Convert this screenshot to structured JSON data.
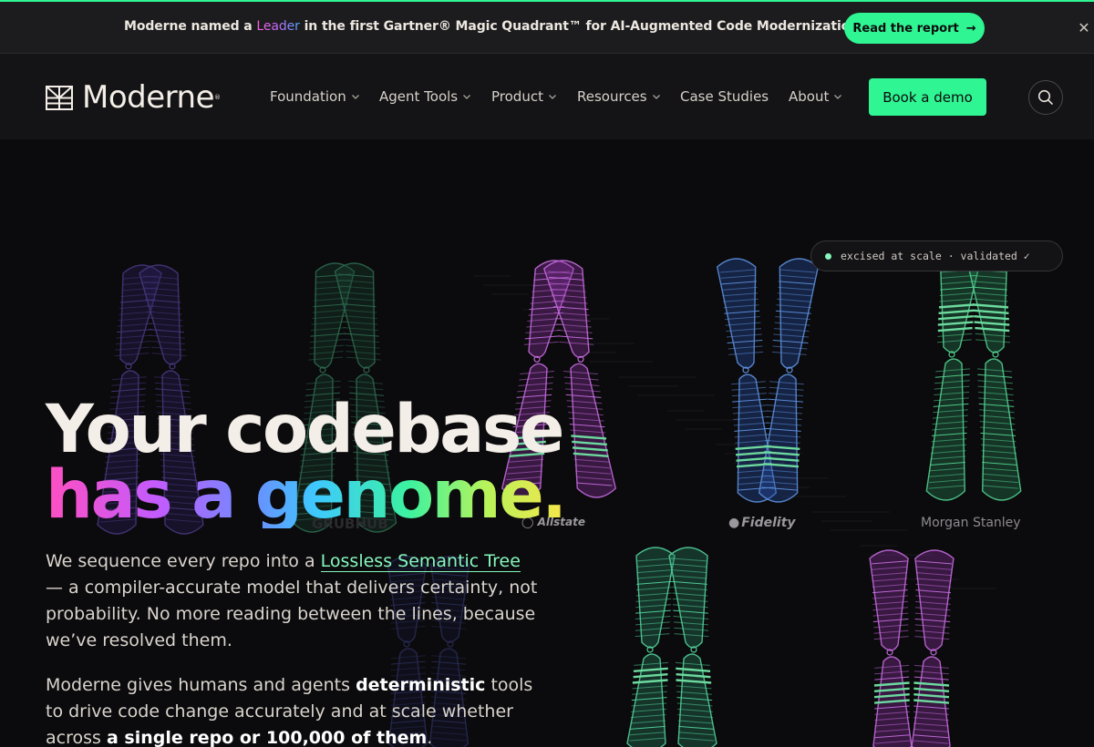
{
  "announcement": {
    "text_before": "Moderne named a ",
    "highlight": "Leader",
    "text_after": " in the first Gartner® Magic Quadrant™ for AI-Augmented Code Modernization Tools.",
    "button_label": "Read the report",
    "button_arrow": "→",
    "close_label": "✕"
  },
  "nav": {
    "logo_text": "Moderne",
    "logo_mark": "®",
    "items": [
      {
        "label": "Foundation",
        "dropdown": true
      },
      {
        "label": "Agent Tools",
        "dropdown": true
      },
      {
        "label": "Product",
        "dropdown": true
      },
      {
        "label": "Resources",
        "dropdown": true
      },
      {
        "label": "Case Studies",
        "dropdown": false
      },
      {
        "label": "About",
        "dropdown": true
      }
    ],
    "cta_label": "Book a demo",
    "search_icon": "search-icon"
  },
  "hero": {
    "badge_text": "excised at scale · validated ✓",
    "headline_line1": "Your codebase",
    "headline_line2": "has a genome.",
    "para1_before": "We sequence every repo into a ",
    "para1_link": "Lossless Semantic Tree",
    "para1_after": " — a compiler-accurate model that delivers certainty, not probability. No more reading between the lines, because we’ve resolved them.",
    "para2_before": "Moderne gives humans and agents ",
    "para2_bold1": "deterministic",
    "para2_mid": " tools to drive code change accurately and at scale whether across ",
    "para2_bold2": "a single repo or 100,000 of them",
    "para2_end": ".",
    "brands": {
      "grubhub": "GRUBHUB",
      "allstate": "Allstate",
      "fidelity": "Fidelity",
      "morgan": "Morgan Stanley"
    }
  },
  "colors": {
    "accent": "#2ff593",
    "background": "#0b0a0c",
    "nav_background": "#141315",
    "link": "#86f7bd"
  }
}
